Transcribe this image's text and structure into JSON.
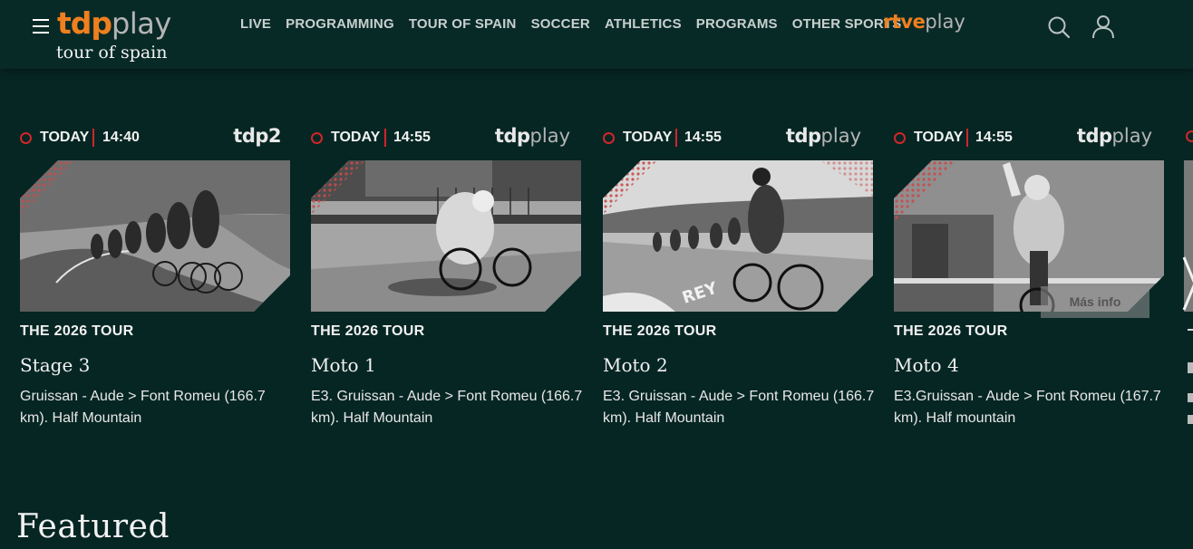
{
  "header": {
    "logo_main": "tdp",
    "logo_play": "play",
    "logo_sub": "tour of spain",
    "nav": [
      "LIVE",
      "PROGRAMMING",
      "TOUR OF SPAIN",
      "SOCCER",
      "ATHLETICS",
      "PROGRAMS",
      "OTHER SPORTS"
    ],
    "rtve_a": "rtve",
    "rtve_b": "play"
  },
  "cards": [
    {
      "day": "TODAY",
      "time": "14:40",
      "channel_a": "tdp2",
      "channel_b": "",
      "series": "THE 2026 TOUR",
      "title": "Stage 3",
      "description": "Gruissan - Aude > Font Romeu (166.7 km). Half Mountain"
    },
    {
      "day": "TODAY",
      "time": "14:55",
      "channel_a": "tdp",
      "channel_b": "play",
      "series": "THE 2026 TOUR",
      "title": "Moto 1",
      "description": "E3. Gruissan - Aude > Font Romeu (166.7 km). Half Mountain"
    },
    {
      "day": "TODAY",
      "time": "14:55",
      "channel_a": "tdp",
      "channel_b": "play",
      "series": "THE 2026 TOUR",
      "title": "Moto 2",
      "description": "E3. Gruissan - Aude > Font Romeu (166.7 km). Half Mountain"
    },
    {
      "day": "TODAY",
      "time": "14:55",
      "channel_a": "tdp",
      "channel_b": "play",
      "series": "THE 2026 TOUR",
      "title": "Moto 4",
      "description": "E3.Gruissan - Aude > Font Romeu (167.7 km). Half mountain"
    }
  ],
  "more_info": "Más info",
  "featured_title": "Featured",
  "colors": {
    "background": "#062623",
    "accent_orange": "#f07f1e",
    "live_red": "#d0262a"
  },
  "icons": [
    "menu-icon",
    "search-icon",
    "user-icon",
    "chevron-right-icon"
  ]
}
